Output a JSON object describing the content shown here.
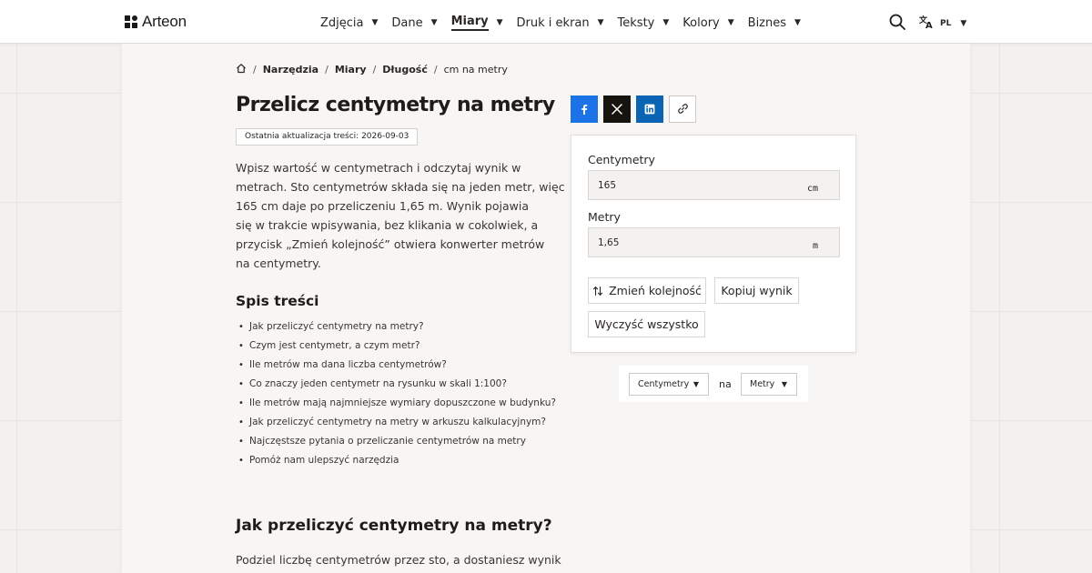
{
  "header": {
    "logo_text": "Arteon",
    "nav": [
      {
        "label": "Zdjęcia"
      },
      {
        "label": "Dane"
      },
      {
        "label": "Miary"
      },
      {
        "label": "Druk i ekran"
      },
      {
        "label": "Teksty"
      },
      {
        "label": "Kolory"
      },
      {
        "label": "Biznes"
      }
    ],
    "active_nav": "Miary",
    "language": "PL"
  },
  "breadcrumb": {
    "items": [
      "Narzędzia",
      "Miary",
      "Długość"
    ],
    "current": "cm na metry"
  },
  "page": {
    "title": "Przelicz centymetry na metry",
    "updated": "Ostatnia aktualizacja treści: 2026-09-03",
    "intro_lines": [
      "Wpisz wartość w centymetrach i odczytaj wynik w",
      "metrach. Sto centymetrów składa się na jeden metr, więc",
      "165 cm daje po przeliczeniu 1,65 m. Wynik pojawia",
      "się w trakcie wpisywania, bez klikania w cokolwiek, a",
      "przycisk „Zmień kolejność” otwiera konwerter metrów",
      "na centymetry."
    ]
  },
  "toc": {
    "title": "Spis treści",
    "items": [
      "Jak przeliczyć centymetry na metry?",
      "Czym jest centymetr, a czym metr?",
      "Ile metrów ma dana liczba centymetrów?",
      "Co znaczy jeden centymetr na rysunku w skali 1:100?",
      "Ile metrów mają najmniejsze wymiary dopuszczone w budynku?",
      "Jak przeliczyć centymetry na metry w arkuszu kalkulacyjnym?",
      "Najczęstsze pytania o przeliczanie centymetrów na metry",
      "Pomóż nam ulepszyć narzędzia"
    ]
  },
  "section": {
    "title": "Jak przeliczyć centymetry na metry?",
    "text": "Podziel liczbę centymetrów przez sto, a dostaniesz wynik"
  },
  "converter": {
    "from_label": "Centymetry",
    "from_value": "165",
    "from_unit": "cm",
    "to_label": "Metry",
    "to_value": "1,65",
    "to_unit": "m",
    "swap_label": "Zmień kolejność",
    "copy_label": "Kopiuj wynik",
    "clear_label": "Wyczyść wszystko"
  },
  "unit_select": {
    "from": "Centymetry",
    "connector": "na",
    "to": "Metry"
  },
  "colors": {
    "facebook": "#1c73e8",
    "x": "#17130f",
    "linkedin": "#0b64b3",
    "text": "#2a2623"
  },
  "share_icons": [
    "facebook-icon",
    "x-icon",
    "linkedin-icon",
    "link-icon"
  ]
}
